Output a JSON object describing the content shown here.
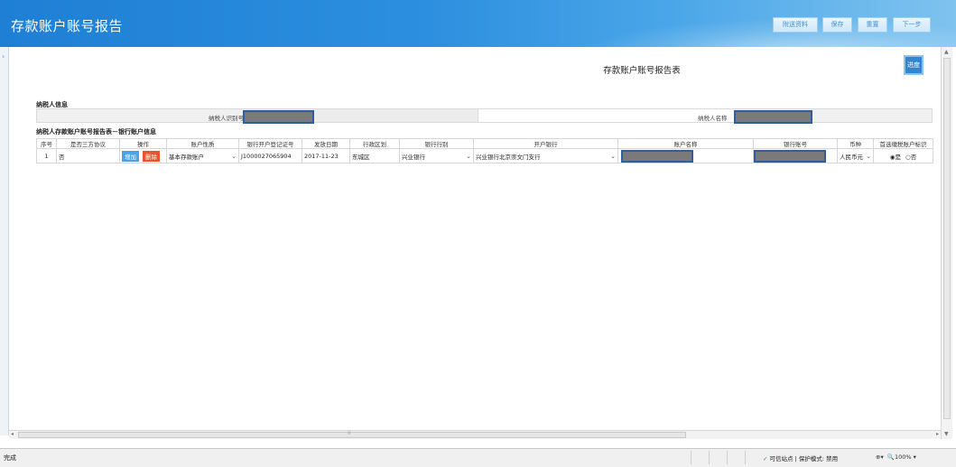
{
  "header": {
    "title": "存款账户账号报告",
    "buttons": {
      "attach": "附送资料",
      "save": "保存",
      "reset": "重置",
      "next": "下一步"
    }
  },
  "main": {
    "doc_title": "存款账户账号报告表",
    "progress_button": "进度",
    "taxpayer_section": "纳税人信息",
    "taxpayer_id_label": "纳税人识别号",
    "taxpayer_name_label": "纳税人名称",
    "bank_section": "纳税人存款账户账号报告表－银行账户信息",
    "columns": [
      "序号",
      "是否三方协议",
      "操作",
      "账户性质",
      "银行开户登记证号",
      "发放日期",
      "行政区划",
      "银行行别",
      "开户银行",
      "账户名称",
      "银行账号",
      "币种",
      "首选缴税账户标识"
    ],
    "rows": [
      {
        "index": "1",
        "tripartite": "否",
        "add": "增加",
        "delete": "删除",
        "account_type": "基本存款账户",
        "license_no": "J1000027065904",
        "issue_date": "2017-11-23",
        "district": "东城区",
        "bank_type": "兴业银行",
        "bank_branch": "兴业银行北京崇文门支行",
        "currency": "人民币元",
        "preferred_yes": "是",
        "preferred_no": "否"
      }
    ]
  },
  "statusbar": {
    "left": "完成",
    "trusted": "可信站点 | 保护模式: 禁用",
    "zoom": "100%"
  },
  "colors": {
    "header": "#2d8fdf",
    "add_button": "#4aa3e6",
    "delete_button": "#e8542d",
    "progress_button": "#2f86d1"
  }
}
